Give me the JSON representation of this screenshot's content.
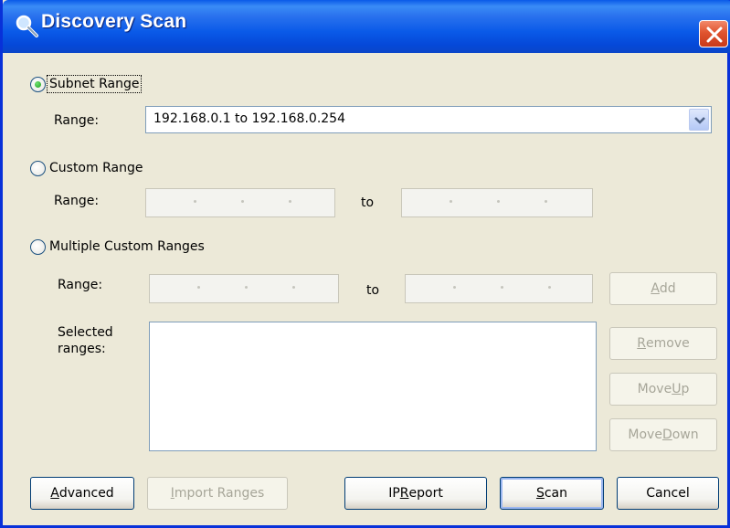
{
  "window": {
    "title": "Discovery Scan",
    "colors": {
      "titlebar": "#0a5ae8",
      "body": "#ece9d8",
      "close": "#e0542f"
    }
  },
  "subnet": {
    "label": "Subnet Range",
    "checked": true,
    "range_label": "Range:",
    "range_value": "192.168.0.1 to 192.168.0.254"
  },
  "custom": {
    "label": "Custom Range",
    "checked": false,
    "range_label": "Range:",
    "to_label": "to"
  },
  "multiple": {
    "label": "Multiple Custom Ranges",
    "checked": false,
    "range_label": "Range:",
    "to_label": "to",
    "selected_label_1": "Selected",
    "selected_label_2": "ranges:",
    "add_button": {
      "pre": "",
      "u": "A",
      "post": "dd"
    },
    "remove_button": {
      "pre": "",
      "u": "R",
      "post": "emove"
    },
    "move_up_button": {
      "pre": "Move ",
      "u": "U",
      "post": "p"
    },
    "move_down_button": {
      "pre": "Move ",
      "u": "D",
      "post": "own"
    }
  },
  "footer": {
    "advanced_button": {
      "pre": "",
      "u": "A",
      "post": "dvanced"
    },
    "import_button": {
      "pre": "",
      "u": "I",
      "post": "mport Ranges"
    },
    "ip_report_button": {
      "pre": "IP ",
      "u": "R",
      "post": "eport"
    },
    "scan_button": {
      "pre": "",
      "u": "S",
      "post": "can"
    },
    "cancel_button": "Cancel"
  }
}
